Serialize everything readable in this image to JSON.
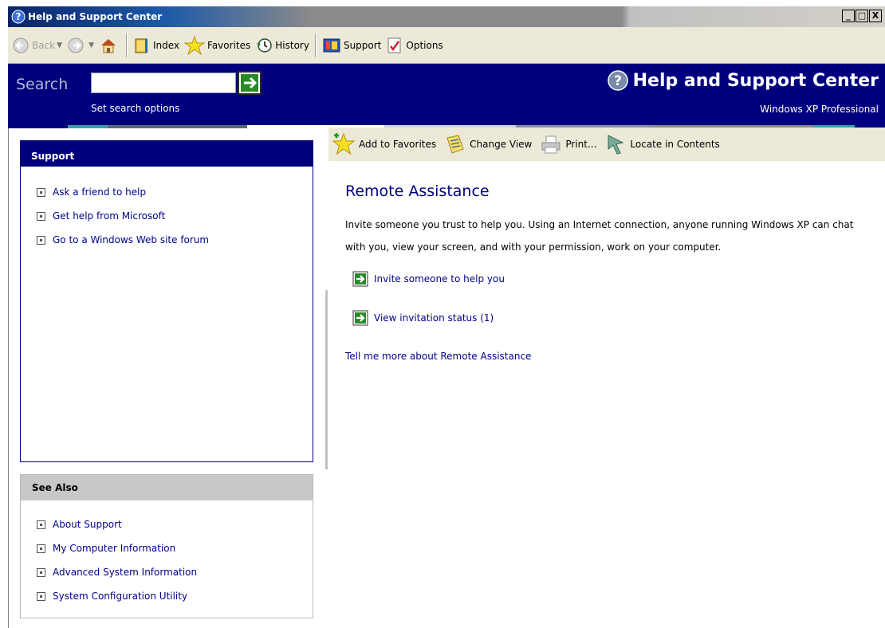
{
  "window": {
    "title": "Help and Support Center",
    "controls": [
      "_",
      "□",
      "X"
    ]
  },
  "toolbar": {
    "back_label": "Back",
    "index_label": "Index",
    "favorites_label": "Favorites",
    "history_label": "History",
    "support_label": "Support",
    "options_label": "Options"
  },
  "search": {
    "label": "Search",
    "value": "",
    "options_link": "Set search options"
  },
  "brand": {
    "title": "Help and Support Center",
    "subtitle": "Windows XP Professional"
  },
  "content_toolbar": {
    "add_favorites": "Add to Favorites",
    "change_view": "Change View",
    "print": "Print...",
    "locate": "Locate in Contents"
  },
  "support_panel": {
    "header": "Support",
    "items": [
      "Ask a friend to help",
      "Get help from Microsoft",
      "Go to a Windows Web site forum"
    ]
  },
  "see_also_panel": {
    "header": "See Also",
    "items": [
      "About Support",
      "My Computer Information",
      "Advanced System Information",
      "System Configuration Utility"
    ]
  },
  "main": {
    "title": "Remote Assistance",
    "description": "Invite someone you trust to help you. Using an Internet connection, anyone running Windows XP can chat with you, view your screen, and with your permission, work on your computer.",
    "actions": [
      "Invite someone to help you",
      "View invitation status (1)"
    ],
    "more_link": "Tell me more about Remote Assistance"
  },
  "colors": {
    "header_blue": "#00007e",
    "link_blue": "#00008b",
    "toolbar_bg": "#ece9d8"
  }
}
